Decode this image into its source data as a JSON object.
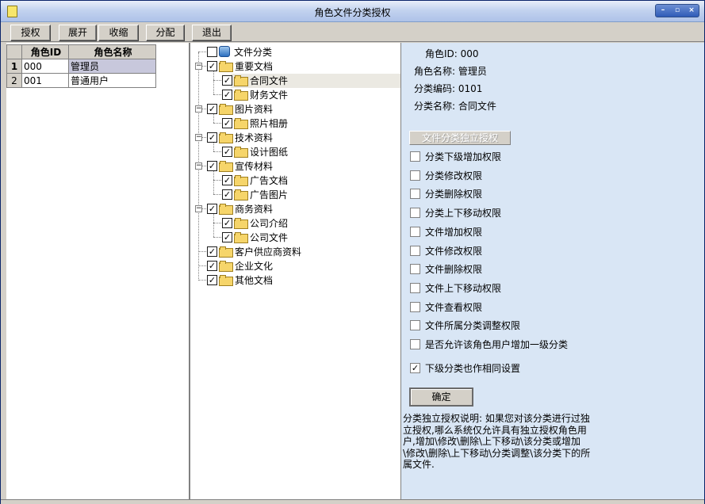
{
  "window": {
    "title": "角色文件分类授权",
    "controls": [
      "minimize-icon",
      "maximize-icon",
      "close-icon"
    ]
  },
  "toolbar": {
    "authorize_label": "授权",
    "expand_label": "展开",
    "collapse_label": "收缩",
    "assign_label": "分配",
    "exit_label": "退出"
  },
  "grid": {
    "columns": [
      "角色ID",
      "角色名称"
    ],
    "rows": [
      {
        "num": "1",
        "id": "000",
        "name": "管理员",
        "selected": true
      },
      {
        "num": "2",
        "id": "001",
        "name": "普通用户",
        "selected": false
      }
    ]
  },
  "tree": {
    "root_label": "文件分类",
    "root_checked": false,
    "nodes": [
      {
        "label": "重要文档",
        "level": 1,
        "checked": true,
        "expanded": true
      },
      {
        "label": "合同文件",
        "level": 2,
        "checked": true,
        "selected": true
      },
      {
        "label": "财务文件",
        "level": 2,
        "checked": true
      },
      {
        "label": "图片资料",
        "level": 1,
        "checked": true,
        "expanded": true
      },
      {
        "label": "照片相册",
        "level": 2,
        "checked": true
      },
      {
        "label": "技术资料",
        "level": 1,
        "checked": true,
        "expanded": true
      },
      {
        "label": "设计图纸",
        "level": 2,
        "checked": true
      },
      {
        "label": "宣传材料",
        "level": 1,
        "checked": true,
        "expanded": true
      },
      {
        "label": "广告文档",
        "level": 2,
        "checked": true
      },
      {
        "label": "广告图片",
        "level": 2,
        "checked": true
      },
      {
        "label": "商务资料",
        "level": 1,
        "checked": true,
        "expanded": true
      },
      {
        "label": "公司介绍",
        "level": 2,
        "checked": true
      },
      {
        "label": "公司文件",
        "level": 2,
        "checked": true
      },
      {
        "label": "客户供应商资料",
        "level": 1,
        "checked": true
      },
      {
        "label": "企业文化",
        "level": 1,
        "checked": true
      },
      {
        "label": "其他文档",
        "level": 1,
        "checked": true
      }
    ]
  },
  "details": {
    "role_id": "角色ID: 000",
    "role_name": "角色名称: 管理员",
    "category_code": "分类编码: 0101",
    "category_name": "分类名称: 合同文件",
    "independent_auth_label": "文件分类独立授权",
    "permissions": [
      {
        "label": "分类下级增加权限",
        "checked": false
      },
      {
        "label": "分类修改权限",
        "checked": false
      },
      {
        "label": "分类删除权限",
        "checked": false
      },
      {
        "label": "分类上下移动权限",
        "checked": false
      },
      {
        "label": "文件增加权限",
        "checked": false
      },
      {
        "label": "文件修改权限",
        "checked": false
      },
      {
        "label": "文件删除权限",
        "checked": false
      },
      {
        "label": "文件上下移动权限",
        "checked": false
      },
      {
        "label": "文件查看权限",
        "checked": false
      },
      {
        "label": "文件所属分类调整权限",
        "checked": false
      },
      {
        "label": "是否允许该角色用户增加一级分类",
        "checked": false
      }
    ],
    "subcategory_same_label": "下级分类也作相同设置",
    "subcategory_same_checked": true,
    "ok_label": "确定",
    "note": "分类独立授权说明: 如果您对该分类进行过独立授权,哪么系统仅允许具有独立授权角色用户,增加\\修改\\删除\\上下移动\\该分类或增加\\修改\\删除\\上下移动\\分类调整\\该分类下的所属文件."
  }
}
